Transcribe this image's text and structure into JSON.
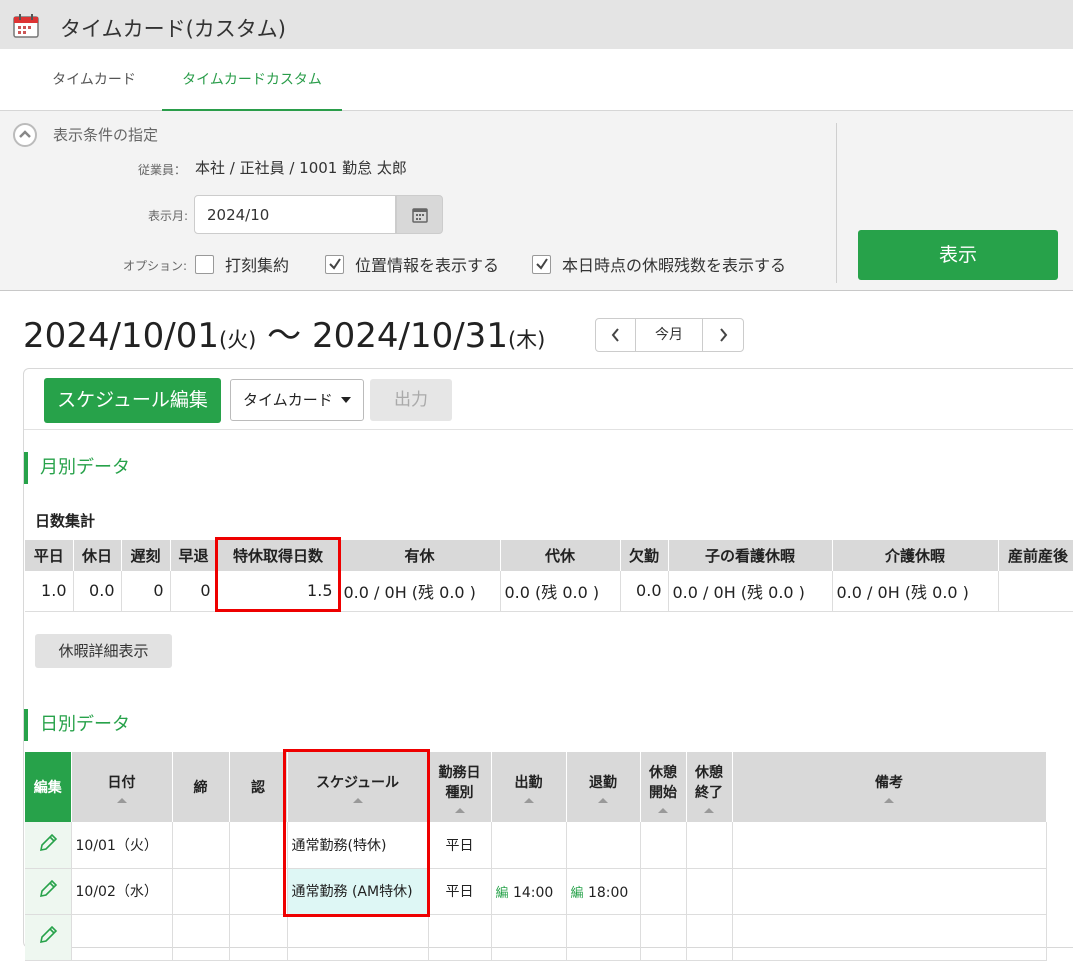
{
  "app": {
    "title": "タイムカード(カスタム)"
  },
  "tabs": [
    {
      "label": "タイムカード"
    },
    {
      "label": "タイムカードカスタム"
    }
  ],
  "conditions": {
    "title": "表示条件の指定",
    "employee_label": "従業員：",
    "employee_value": "本社 / 正社員 / 1001 勤怠 太郎",
    "month_label": "表示月:",
    "month_value": "2024/10",
    "options_label": "オプション:",
    "options": [
      {
        "label": "打刻集約",
        "checked": false
      },
      {
        "label": "位置情報を表示する",
        "checked": true
      },
      {
        "label": "本日時点の休暇残数を表示する",
        "checked": true
      }
    ],
    "show_button": "表示"
  },
  "range": {
    "start": "2024/10/01",
    "start_dow": "(火)",
    "sep": "〜",
    "end": "2024/10/31",
    "end_dow": "(木)"
  },
  "nav": {
    "prev": "‹",
    "today": "今月",
    "next": "›"
  },
  "toolbar": {
    "schedule_button": "スケジュール編集",
    "select_value": "タイムカード",
    "output_button": "出力"
  },
  "monthly": {
    "title": "月別データ",
    "subtitle": "日数集計",
    "headers": [
      "平日",
      "休日",
      "遅刻",
      "早退",
      "特休取得日数",
      "有休",
      "代休",
      "欠勤",
      "子の看護休暇",
      "介護休暇",
      "産前産後"
    ],
    "values": [
      "1.0",
      "0.0",
      "0",
      "0",
      "1.5",
      "0.0 / 0H (残 0.0 )",
      "0.0 (残 0.0 )",
      "0.0",
      "0.0 / 0H (残 0.0 )",
      "0.0 / 0H (残 0.0 )",
      ""
    ],
    "detail_button": "休暇詳細表示"
  },
  "daily": {
    "title": "日別データ",
    "headers": {
      "edit": "編集",
      "date": "日付",
      "close": "締",
      "approve": "認",
      "schedule": "スケジュール",
      "type_1": "勤務日",
      "type_2": "種別",
      "in": "出勤",
      "out": "退勤",
      "break_start_1": "休憩",
      "break_start_2": "開始",
      "break_end_1": "休憩",
      "break_end_2": "終了",
      "note": "備考"
    },
    "rows": [
      {
        "date": "10/01（火）",
        "schedule": "通常勤務(特休)",
        "type": "平日",
        "in_tag": "",
        "in": "",
        "out_tag": "",
        "out": ""
      },
      {
        "date": "10/02（水）",
        "schedule": "通常勤務 (AM特休)",
        "type": "平日",
        "in_tag": "編",
        "in": "14:00",
        "out_tag": "編",
        "out": "18:00"
      }
    ]
  },
  "colors": {
    "accent": "#27a24a",
    "highlight": "#e00000"
  }
}
